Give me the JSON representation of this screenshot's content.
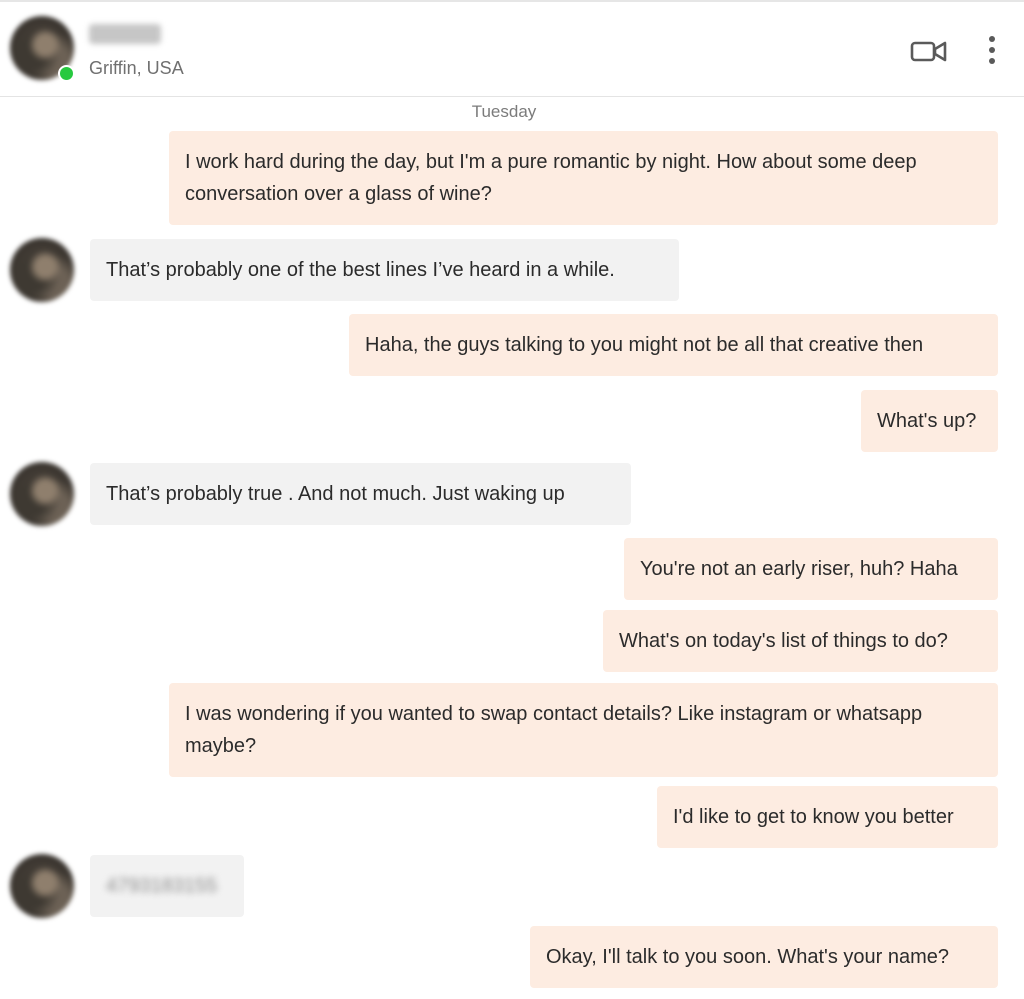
{
  "header": {
    "contact_name": "sayeda",
    "location": "Griffin, USA",
    "online": true
  },
  "icons": {
    "video": "video-camera-icon",
    "more": "more-vertical-icon",
    "online_color": "#27c93f"
  },
  "day_label": "Tuesday",
  "colors": {
    "outgoing_bubble": "#fdece1",
    "incoming_bubble": "#f2f2f2"
  },
  "messages": [
    {
      "dir": "out",
      "text": "I work hard during the day, but I'm a pure romantic by night. How about some deep conversation over a glass of wine?"
    },
    {
      "dir": "in",
      "text": "That’s probably one of the best lines I’ve heard in a while."
    },
    {
      "dir": "out",
      "text": "Haha, the guys talking to you might not be all that creative then"
    },
    {
      "dir": "out",
      "text": "What's up?"
    },
    {
      "dir": "in",
      "text": "That’s probably true . And not much. Just waking up"
    },
    {
      "dir": "out",
      "text": "You're not an early riser, huh? Haha"
    },
    {
      "dir": "out",
      "text": "What's on today's list of things to do?"
    },
    {
      "dir": "out",
      "text": "I was wondering if you wanted to swap contact details? Like instagram or whatsapp maybe?"
    },
    {
      "dir": "out",
      "text": "I'd like to get to know you better"
    },
    {
      "dir": "in",
      "text": "4793183155"
    },
    {
      "dir": "out",
      "text": "Okay, I'll talk to you soon. What's your name?"
    }
  ]
}
